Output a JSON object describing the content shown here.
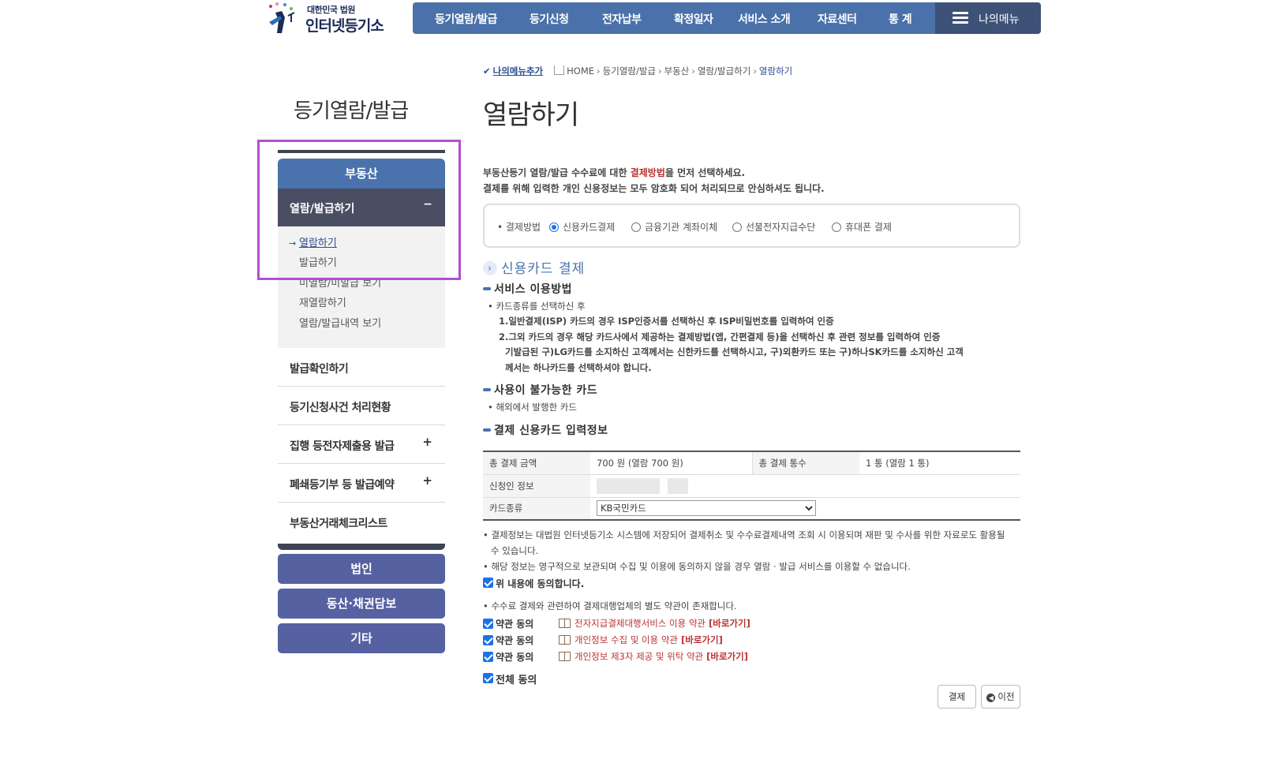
{
  "header": {
    "logo_small": "대한민국 법원",
    "logo_main": "인터넷등기소",
    "nav": [
      "등기열람/발급",
      "등기신청",
      "전자납부",
      "확정일자",
      "서비스 소개",
      "자료센터",
      "통 계"
    ],
    "my_menu": "나의메뉴"
  },
  "lnb": {
    "title": "등기열람/발급",
    "realestate": "부동산",
    "selected": "열람/발급하기",
    "selected_toggle": "−",
    "sub_items": [
      "열람하기",
      "발급하기",
      "미열람/미발급 보기",
      "재열람하기",
      "열람/발급내역 보기"
    ],
    "rows": [
      {
        "label": "발급확인하기",
        "toggle": ""
      },
      {
        "label": "등기신청사건 처리현황",
        "toggle": ""
      },
      {
        "label": "집행 등전자제출용 발급",
        "toggle": "+"
      },
      {
        "label": "폐쇄등기부 등 발급예약",
        "toggle": "+"
      },
      {
        "label": "부동산거래체크리스트",
        "toggle": ""
      }
    ],
    "buttons": [
      "법인",
      "동산·채권담보",
      "기타"
    ]
  },
  "breadcrumb": {
    "add_menu": "나의메뉴추가",
    "items": [
      "HOME",
      "등기열람/발급",
      "부동산",
      "열람/발급하기"
    ],
    "current": "열람하기"
  },
  "page_title": "열람하기",
  "intro": {
    "line1_a": "부동산등기 열람/발급 수수료에 대한 ",
    "line1_red": "결제방법",
    "line1_b": "을 먼저 선택하세요.",
    "line2": "결제를 위해 입력한 개인 신용정보는 모두 암호화 되어 처리되므로 안심하셔도 됩니다."
  },
  "payment": {
    "label": "• 결제방법",
    "options": [
      "신용카드결제",
      "금융기관 계좌이체",
      "선불전자지급수단",
      "휴대폰 결제"
    ],
    "selected_index": 0
  },
  "card_section": {
    "title": "신용카드 결제",
    "usage_title": "서비스 이용방법",
    "usage_lines": [
      "• 카드종류를 선택하신 후",
      "1.일반결제(ISP) 카드의 경우 ISP인증서를 선택하신 후 ISP비밀번호를 입력하여 인증",
      "2.그외 카드의 경우 해당 카드사에서 제공하는 결제방법(앱, 간편결제 등)을 선택하신 후 관련 정보를 입력하여 인증",
      "기발급된 구)LG카드를 소지하신 고객께서는 신한카드를 선택하시고, 구)외환카드 또는 구)하나SK카드를 소지하신 고객",
      "께서는 하나카드를 선택하셔야 합니다."
    ],
    "unusable_title": "사용이 불가능한 카드",
    "unusable_line": "• 해외에서 발행한 카드",
    "input_title": "결제 신용카드 입력정보"
  },
  "table": {
    "total_amount_label": "총 결제 금액",
    "total_amount_value": "700 원 (열람 700 원)",
    "total_count_label": "총 결제 통수",
    "total_count_value": "1 통 (열람 1 통)",
    "applicant_label": "신청인 정보",
    "card_type_label": "카드종류",
    "card_type_value": "KB국민카드"
  },
  "notices": {
    "n1a": "• 결제정보는 대법원 인터넷등기소 시스템에 저장되어 결제취소 및 수수료결제내역 조회 시 이용되며 재판 및 수사를 위한 자료로도 활용될",
    "n1b": "수 있습니다.",
    "n2": "• 해당 정보는 영구적으로 보관되며 수집 및 이용에 동의하지 않을 경우 열람 · 발급 서비스를 이용할 수 없습니다.",
    "agree_above": "위 내용에 동의합니다.",
    "n3": "• 수수료 결제와 관련하여 결제대행업체의 별도 약관이 존재합니다."
  },
  "terms": [
    {
      "agree": "약관 동의",
      "title": "전자지급결제대행서비스 이용 약관",
      "link": "[바로가기]"
    },
    {
      "agree": "약관 동의",
      "title": "개인정보 수집 및 이용 약관",
      "link": "[바로가기]"
    },
    {
      "agree": "약관 동의",
      "title": "개인정보 제3자 제공 및 위탁 약관",
      "link": "[바로가기]"
    }
  ],
  "agree_all": "전체 동의",
  "buttons": {
    "pay": "결제",
    "prev": "이전"
  },
  "colors": {
    "accent": "#4a73ad",
    "nav": "#4a71a9",
    "highlight": "#b24fd0"
  }
}
